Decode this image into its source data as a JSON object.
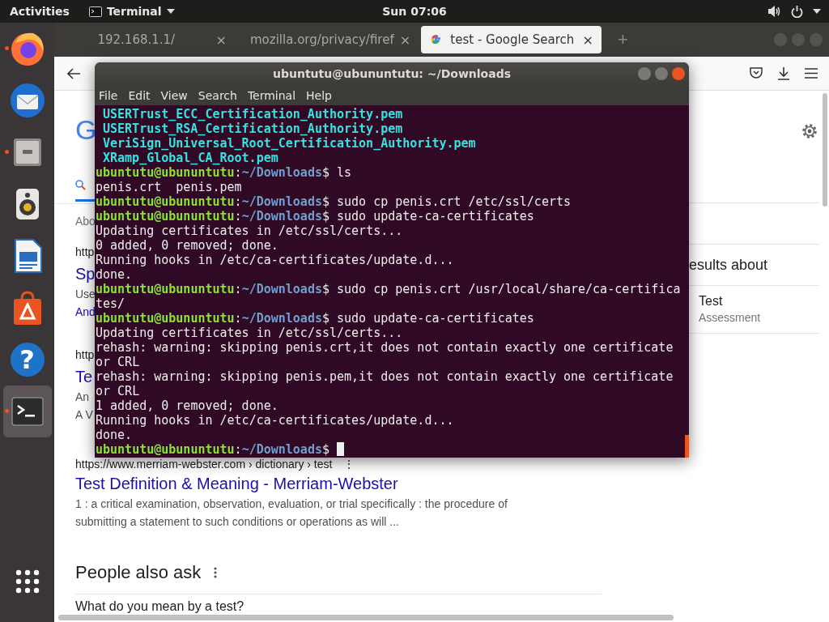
{
  "top_bar": {
    "activities": "Activities",
    "app_menu": "Terminal",
    "clock": "Sun 07:06"
  },
  "dock": [
    {
      "kind": "browser",
      "running": true,
      "active": false
    },
    {
      "kind": "mail",
      "running": false,
      "active": false
    },
    {
      "kind": "files",
      "running": true,
      "active": false
    },
    {
      "kind": "music",
      "running": false,
      "active": false
    },
    {
      "kind": "writer",
      "running": false,
      "active": false
    },
    {
      "kind": "software",
      "running": false,
      "active": false
    },
    {
      "kind": "help",
      "glyph": "?",
      "running": false,
      "active": false
    },
    {
      "kind": "terminal",
      "running": true,
      "active": true
    },
    {
      "kind": "apps",
      "running": false,
      "active": false
    }
  ],
  "browser": {
    "tabs": [
      {
        "kind": "plain",
        "title": "192.168.1.1/",
        "close": "×",
        "selected": false
      },
      {
        "kind": "warning",
        "title": "mozilla.org/privacy/firef",
        "close": "×",
        "selected": false
      },
      {
        "kind": "google",
        "title": "test - Google Search",
        "close": "×",
        "selected": true
      }
    ],
    "new_tab": "+",
    "page": {
      "logo": "G",
      "about": "Abo",
      "results": [
        {
          "url": "http",
          "title": "Sp",
          "snippets": [
            {
              "kind": "text",
              "text": "Use"
            },
            {
              "kind": "link",
              "text": "And"
            }
          ]
        },
        {
          "url": "http",
          "title": "Te",
          "snippets": [
            {
              "kind": "text",
              "text": "An"
            },
            {
              "kind": "text",
              "text": "A V"
            }
          ]
        },
        {
          "url": "https://www.merriam-webster.com › dictionary › test",
          "more": "⋮",
          "title": "Test Definition & Meaning - Merriam-Webster",
          "snippets": [
            {
              "kind": "text",
              "text": "1 : a critical examination, observation, evaluation, or trial specifically : the procedure of submitting a statement to such conditions or operations as will ..."
            }
          ]
        }
      ],
      "people_also_ask": "People also ask",
      "question": "What do you mean by a test?",
      "side_heading": "esults about",
      "side_item": {
        "title": "Test",
        "subtitle": "Assessment"
      }
    }
  },
  "terminal": {
    "title": "ubuntutu@ubununtutu: ~/Downloads",
    "menu": [
      "File",
      "Edit",
      "View",
      "Search",
      "Terminal",
      "Help"
    ],
    "lines": [
      {
        "kind": "file",
        "text": "USERTrust_ECC_Certification_Authority.pem"
      },
      {
        "kind": "file",
        "text": "USERTrust_RSA_Certification_Authority.pem"
      },
      {
        "kind": "file",
        "text": "VeriSign_Universal_Root_Certification_Authority.pem"
      },
      {
        "kind": "file",
        "text": "XRamp_Global_CA_Root.pem"
      },
      {
        "kind": "prompt",
        "user": "ubuntutu@ubununtutu",
        "colon": ":",
        "path": "~/Downloads",
        "sign": "$",
        "command": "ls"
      },
      {
        "kind": "output",
        "text": "penis.crt  penis.pem"
      },
      {
        "kind": "prompt",
        "user": "ubuntutu@ubununtutu",
        "colon": ":",
        "path": "~/Downloads",
        "sign": "$",
        "command": "sudo cp penis.crt /etc/ssl/certs"
      },
      {
        "kind": "prompt",
        "user": "ubuntutu@ubununtutu",
        "colon": ":",
        "path": "~/Downloads",
        "sign": "$",
        "command": "sudo update-ca-certificates"
      },
      {
        "kind": "output",
        "text": "Updating certificates in /etc/ssl/certs..."
      },
      {
        "kind": "output",
        "text": "0 added, 0 removed; done."
      },
      {
        "kind": "output",
        "text": "Running hooks in /etc/ca-certificates/update.d..."
      },
      {
        "kind": "output",
        "text": "done."
      },
      {
        "kind": "prompt",
        "user": "ubuntutu@ubununtutu",
        "colon": ":",
        "path": "~/Downloads",
        "sign": "$",
        "command": "sudo cp penis.crt /usr/local/share/ca-certifica"
      },
      {
        "kind": "output",
        "text": "tes/"
      },
      {
        "kind": "prompt",
        "user": "ubuntutu@ubununtutu",
        "colon": ":",
        "path": "~/Downloads",
        "sign": "$",
        "command": "sudo update-ca-certificates"
      },
      {
        "kind": "output",
        "text": "Updating certificates in /etc/ssl/certs..."
      },
      {
        "kind": "output",
        "text": "rehash: warning: skipping penis.crt,it does not contain exactly one certificate"
      },
      {
        "kind": "output",
        "text": "or CRL"
      },
      {
        "kind": "output",
        "text": "rehash: warning: skipping penis.pem,it does not contain exactly one certificate"
      },
      {
        "kind": "output",
        "text": "or CRL"
      },
      {
        "kind": "output",
        "text": "1 added, 0 removed; done."
      },
      {
        "kind": "output",
        "text": "Running hooks in /etc/ca-certificates/update.d..."
      },
      {
        "kind": "output",
        "text": "done."
      },
      {
        "kind": "prompt",
        "user": "ubuntutu@ubununtutu",
        "colon": ":",
        "path": "~/Downloads",
        "sign": "$",
        "cursor": true
      }
    ]
  }
}
